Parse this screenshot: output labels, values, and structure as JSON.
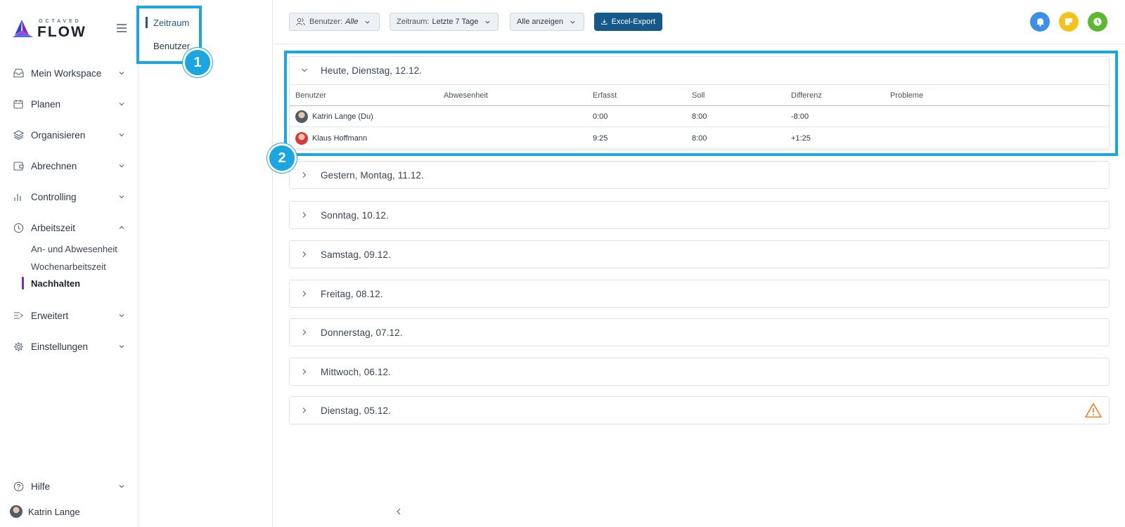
{
  "logo": {
    "small": "OCTAVED",
    "big": "FLOW"
  },
  "sidebar": {
    "items": [
      {
        "label": "Mein Workspace",
        "icon": "inbox-icon"
      },
      {
        "label": "Planen",
        "icon": "calendar-icon"
      },
      {
        "label": "Organisieren",
        "icon": "layers-icon"
      },
      {
        "label": "Abrechnen",
        "icon": "wallet-icon"
      },
      {
        "label": "Controlling",
        "icon": "bar-chart-icon"
      },
      {
        "label": "Arbeitszeit",
        "icon": "clock-icon"
      },
      {
        "label": "Erweitert",
        "icon": "list-arrow-icon"
      },
      {
        "label": "Einstellungen",
        "icon": "gear-icon"
      },
      {
        "label": "Hilfe",
        "icon": "help-circle-icon"
      }
    ],
    "sub_items": [
      "An- und Abwesenheit",
      "Wochenarbeitszeit",
      "Nachhalten"
    ],
    "user": "Katrin Lange"
  },
  "subpanel": {
    "items": [
      "Zeitraum",
      "Benutzer"
    ]
  },
  "callouts": [
    "1",
    "2"
  ],
  "toolbar": {
    "user_filter_label": "Benutzer:",
    "user_filter_value": "Alle",
    "period_label": "Zeitraum:",
    "period_value": "Letzte 7 Tage",
    "show_all": "Alle anzeigen",
    "export": "Excel-Export"
  },
  "table": {
    "headers": [
      "Benutzer",
      "Abwesenheit",
      "Erfasst",
      "Soll",
      "Differenz",
      "Probleme"
    ],
    "rows": [
      {
        "user": "Katrin Lange (Du)",
        "absence": "",
        "recorded": "0:00",
        "target": "8:00",
        "diff": "-8:00",
        "problems": ""
      },
      {
        "user": "Klaus Hoffmann",
        "absence": "",
        "recorded": "9:25",
        "target": "8:00",
        "diff": "+1:25",
        "problems": ""
      }
    ]
  },
  "days": [
    "Heute, Dienstag, 12.12.",
    "Gestern, Montag, 11.12.",
    "Sonntag, 10.12.",
    "Samstag, 09.12.",
    "Freitag, 08.12.",
    "Donnerstag, 07.12.",
    "Mittwoch, 06.12.",
    "Dienstag, 05.12."
  ],
  "colors": {
    "brand_blue": "#14598a",
    "callout": "#1aa6e0",
    "active_nav": "#7b2fb8",
    "warning": "#f07c1a",
    "bell": "#3b8fe8",
    "note": "#f2c31b",
    "timer": "#5cb82e"
  }
}
